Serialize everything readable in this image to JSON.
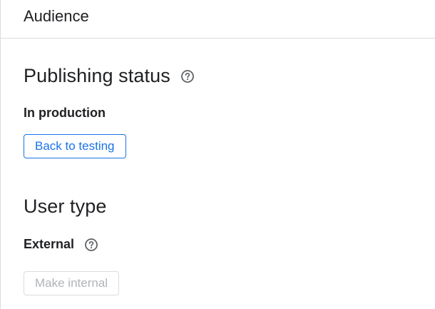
{
  "header": {
    "title": "Audience"
  },
  "publishing": {
    "title": "Publishing status",
    "help_icon": "help-circle-icon",
    "status": "In production",
    "button_label": "Back to testing"
  },
  "user_type": {
    "title": "User type",
    "value": "External",
    "help_icon": "help-circle-icon",
    "button_label": "Make internal",
    "button_disabled": true
  },
  "colors": {
    "accent": "#1a73e8",
    "divider": "#dadce0",
    "text": "#202124",
    "disabled_text": "#b0b3b8"
  }
}
